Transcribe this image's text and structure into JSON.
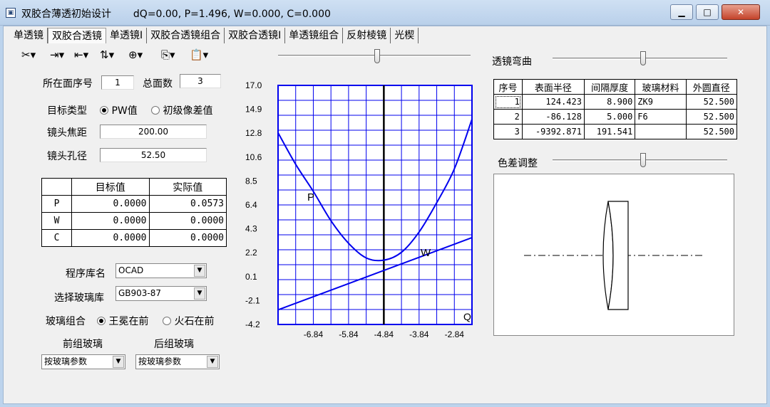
{
  "window": {
    "title": "双胶合薄透初始设计",
    "status": "dQ=0.00,   P=1.496,   W=0.000,   C=0.000",
    "buttons": {
      "minimize": "▁",
      "maximize": "□",
      "close": "✕"
    }
  },
  "tabs": [
    "单透镜",
    "双胶合透镜",
    "单透镜Ⅰ",
    "双胶合透镜组合",
    "双胶合透镜Ⅰ",
    "单透镜组合",
    "反射棱镜",
    "光楔"
  ],
  "toolbar": {
    "icons": [
      "cut-icon",
      "indent-icon",
      "outdent-icon",
      "sort-icon",
      "zoom-icon",
      "copy-icon",
      "paste-icon"
    ]
  },
  "left": {
    "surface_no_label": "所在面序号",
    "surface_no_value": "1",
    "total_label": "总面数",
    "total_value": "3",
    "target_type_label": "目标类型",
    "opt_pw": "PW值",
    "opt_aberr": "初级像差值",
    "focal_label": "镜头焦距",
    "focal_value": "200.00",
    "aperture_label": "镜头孔径",
    "aperture_value": "52.50",
    "table": {
      "headers": [
        "",
        "目标值",
        "实际值"
      ],
      "rows": [
        [
          "P",
          "0.0000",
          "0.0573"
        ],
        [
          "W",
          "0.0000",
          "0.0000"
        ],
        [
          "C",
          "0.0000",
          "0.0000"
        ]
      ]
    },
    "library_label": "程序库名",
    "library_value": "OCAD",
    "glasslib_label": "选择玻璃库",
    "glasslib_value": "GB903-87",
    "combo_label": "玻璃组合",
    "opt_crown": "王冕在前",
    "opt_flint": "火石在前",
    "front_label": "前组玻璃",
    "back_label": "后组玻璃",
    "front_value": "按玻璃参数",
    "back_value": "按玻璃参数"
  },
  "chart_data": {
    "type": "line",
    "yticks": [
      "17.0",
      "14.9",
      "12.8",
      "10.6",
      "8.5",
      "6.4",
      "4.3",
      "2.2",
      "0.1",
      "-2.1",
      "-4.2"
    ],
    "xticks": [
      "-6.84",
      "-5.84",
      "-4.84",
      "-3.84",
      "-2.84"
    ],
    "xlim": [
      -7.84,
      -2.34
    ],
    "ylim": [
      -4.2,
      17.0
    ],
    "series": [
      {
        "name": "P",
        "x": [
          -7.84,
          -7.34,
          -6.84,
          -6.34,
          -5.84,
          -5.34,
          -4.84,
          -4.34,
          -3.84,
          -3.34,
          -2.84,
          -2.34
        ],
        "y": [
          12.8,
          10.0,
          7.6,
          5.0,
          3.0,
          1.7,
          1.5,
          2.2,
          4.0,
          6.6,
          9.6,
          14.0
        ]
      },
      {
        "name": "W",
        "x": [
          -7.84,
          -2.34
        ],
        "y": [
          -2.9,
          3.5
        ]
      }
    ],
    "curve_labels": [
      "P",
      "W",
      "Q"
    ],
    "vline_x": -4.84,
    "color": "#0000ee"
  },
  "right": {
    "bend_label": "透镜弯曲",
    "table": {
      "headers": [
        "序号",
        "表面半径",
        "间隔厚度",
        "玻璃材料",
        "外圆直径"
      ],
      "rows": [
        [
          "1",
          "124.423",
          "8.900",
          "ZK9",
          "52.500"
        ],
        [
          "2",
          "-86.128",
          "5.000",
          "F6",
          "52.500"
        ],
        [
          "3",
          "-9392.871",
          "191.541",
          "",
          "52.500"
        ]
      ]
    },
    "chroma_label": "色差调整"
  }
}
